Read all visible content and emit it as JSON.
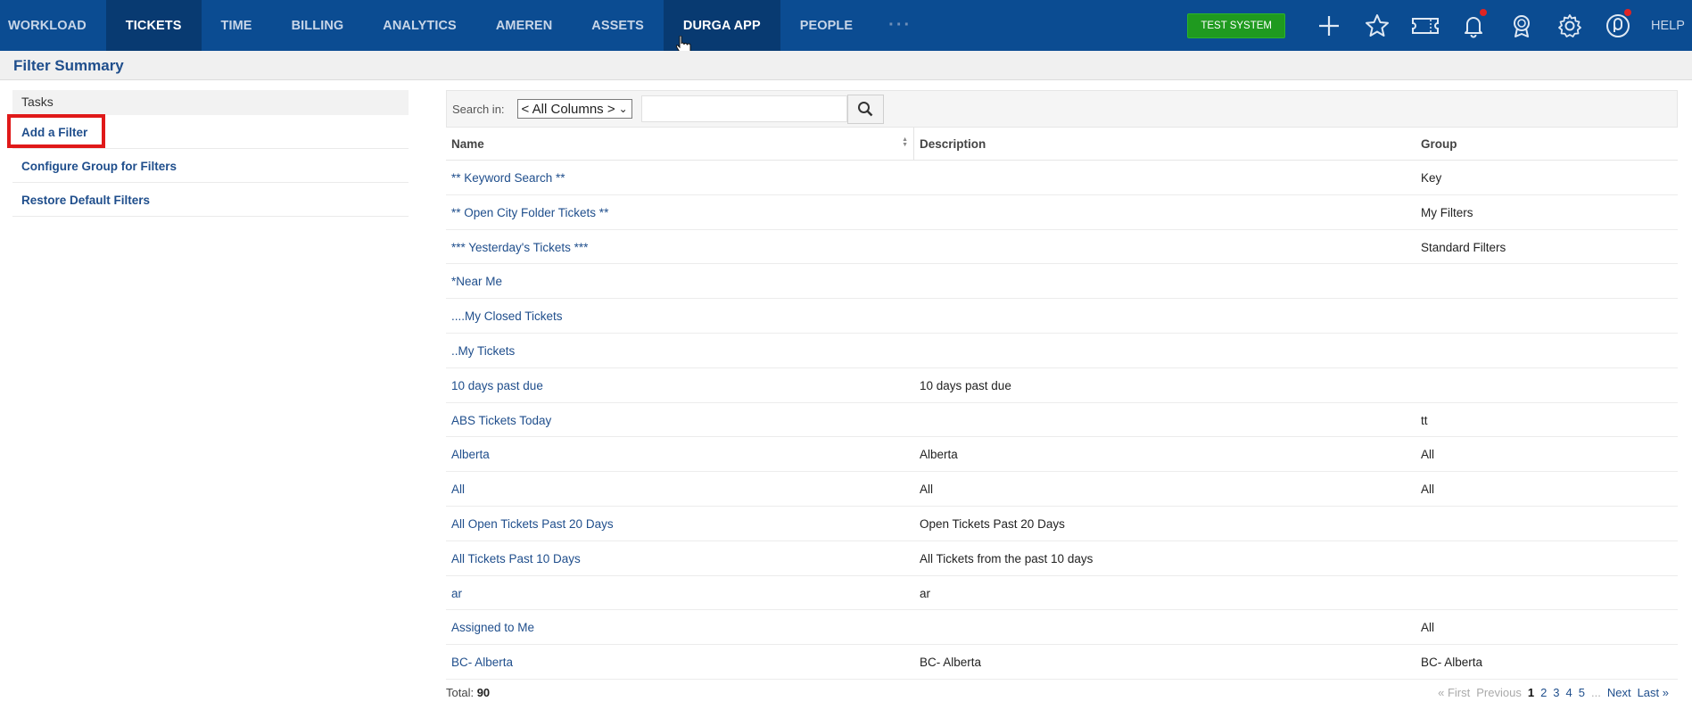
{
  "nav": {
    "tabs": [
      {
        "label": "WORKLOAD"
      },
      {
        "label": "TICKETS"
      },
      {
        "label": "TIME"
      },
      {
        "label": "BILLING"
      },
      {
        "label": "ANALYTICS"
      },
      {
        "label": "AMEREN"
      },
      {
        "label": "ASSETS"
      },
      {
        "label": "DURGA APP"
      },
      {
        "label": "PEOPLE"
      }
    ],
    "more": "···",
    "test_system": "TEST SYSTEM",
    "help": "HELP",
    "icons": [
      "plus-icon",
      "star-icon",
      "ticket-icon",
      "bell-icon",
      "award-icon",
      "gear-icon",
      "user-icon"
    ]
  },
  "page_title": "Filter Summary",
  "tasks": {
    "header": "Tasks",
    "items": [
      {
        "label": "Add a Filter"
      },
      {
        "label": "Configure Group for Filters"
      },
      {
        "label": "Restore Default Filters"
      }
    ]
  },
  "search": {
    "label": "Search in:",
    "select_value": "< All Columns >",
    "input_value": ""
  },
  "table": {
    "headers": {
      "name": "Name",
      "description": "Description",
      "group": "Group"
    },
    "rows": [
      {
        "name": "** Keyword Search **",
        "description": "",
        "group": "Key"
      },
      {
        "name": "** Open City Folder Tickets **",
        "description": "",
        "group": "My Filters"
      },
      {
        "name": "*** Yesterday's Tickets ***",
        "description": "",
        "group": "Standard Filters"
      },
      {
        "name": "*Near Me",
        "description": "",
        "group": ""
      },
      {
        "name": "....My Closed Tickets",
        "description": "",
        "group": ""
      },
      {
        "name": "..My Tickets",
        "description": "",
        "group": ""
      },
      {
        "name": "10 days past due",
        "description": "10 days past due",
        "group": ""
      },
      {
        "name": "ABS Tickets Today",
        "description": "",
        "group": "tt"
      },
      {
        "name": "Alberta",
        "description": "Alberta",
        "group": "All"
      },
      {
        "name": "All",
        "description": "All",
        "group": "All"
      },
      {
        "name": "All Open Tickets Past 20 Days",
        "description": "Open Tickets Past 20 Days",
        "group": ""
      },
      {
        "name": "All Tickets Past 10 Days",
        "description": "All Tickets from the past 10 days",
        "group": ""
      },
      {
        "name": "ar",
        "description": "ar",
        "group": ""
      },
      {
        "name": "Assigned to Me",
        "description": "",
        "group": "All"
      },
      {
        "name": "BC- Alberta",
        "description": "BC- Alberta",
        "group": "BC- Alberta"
      }
    ]
  },
  "footer": {
    "total_label": "Total:",
    "total_value": "90",
    "pager": {
      "first": "« First",
      "previous": "Previous",
      "pages": [
        "1",
        "2",
        "3",
        "4",
        "5"
      ],
      "ellipsis": "...",
      "next": "Next",
      "last": "Last »"
    }
  },
  "colors": {
    "nav_bg": "#0b4c92",
    "nav_active": "#083a71",
    "link": "#1f4e8c",
    "test_system": "#1f9a1f",
    "highlight": "#e01919"
  }
}
